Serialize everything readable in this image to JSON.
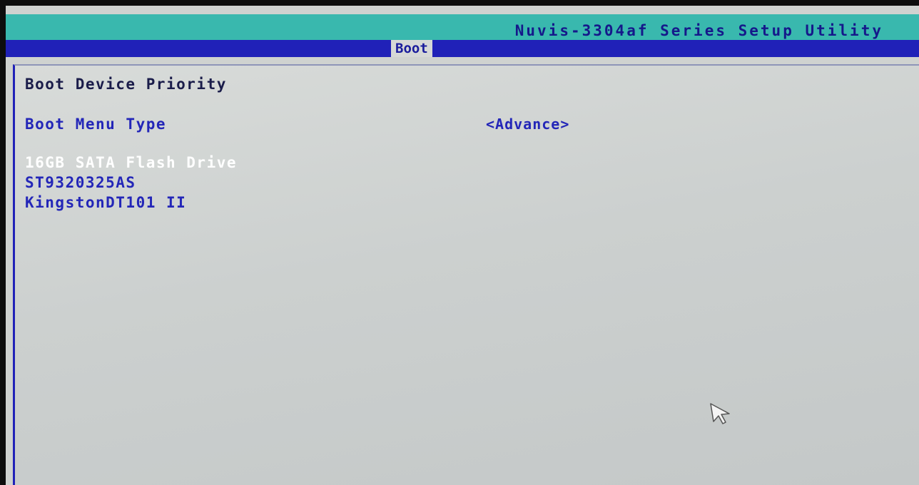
{
  "header": {
    "utility_title": "Nuvis-3304af Series Setup Utility",
    "active_tab": "Boot"
  },
  "page": {
    "heading": "Boot Device Priority",
    "boot_menu_type": {
      "label": "Boot Menu Type",
      "value": "<Advance>"
    },
    "devices": [
      {
        "label": "16GB SATA Flash Drive",
        "selected": true
      },
      {
        "label": "ST9320325AS",
        "selected": false
      },
      {
        "label": "KingstonDT101 II",
        "selected": false
      }
    ]
  },
  "colors": {
    "title_bar": "#39b8ae",
    "tab_bar": "#2021b8",
    "body_bg": "#cfd2d0",
    "text_blue": "#2326b8",
    "selected_text": "#ffffff"
  },
  "icons": {
    "pointer": "mouse-pointer-icon"
  }
}
